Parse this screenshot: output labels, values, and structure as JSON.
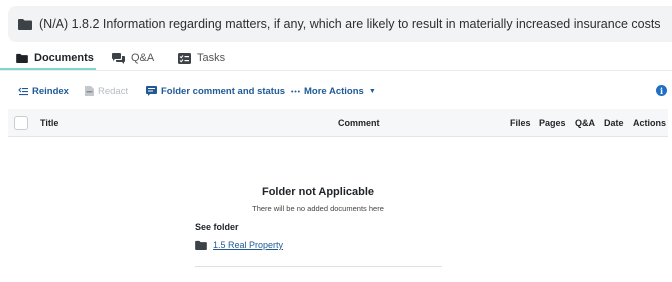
{
  "folder": {
    "title": "(N/A) 1.8.2 Information regarding matters, if any, which are likely to result in materially increased insurance costs"
  },
  "tabs": [
    {
      "label": "Documents",
      "icon": "folder-icon",
      "active": true
    },
    {
      "label": "Q&A",
      "icon": "chat-icon",
      "active": false
    },
    {
      "label": "Tasks",
      "icon": "tasks-icon",
      "active": false
    }
  ],
  "toolbar": {
    "reindex": "Reindex",
    "redact": "Redact",
    "folder_comment": "Folder comment and status",
    "more_actions": "More Actions"
  },
  "table": {
    "columns": [
      "Title",
      "Comment",
      "Files",
      "Pages",
      "Q&A",
      "Date",
      "Actions"
    ]
  },
  "empty_state": {
    "title": "Folder not Applicable",
    "subtitle": "There will be no added documents here",
    "see_folder_label": "See folder",
    "linked_folder": "1.5 Real Property"
  },
  "colors": {
    "accent_link": "#1f5a96",
    "tab_underline": "#7fd6cf",
    "info_badge": "#1f6fc2",
    "header_bg": "#f2f3f5"
  }
}
